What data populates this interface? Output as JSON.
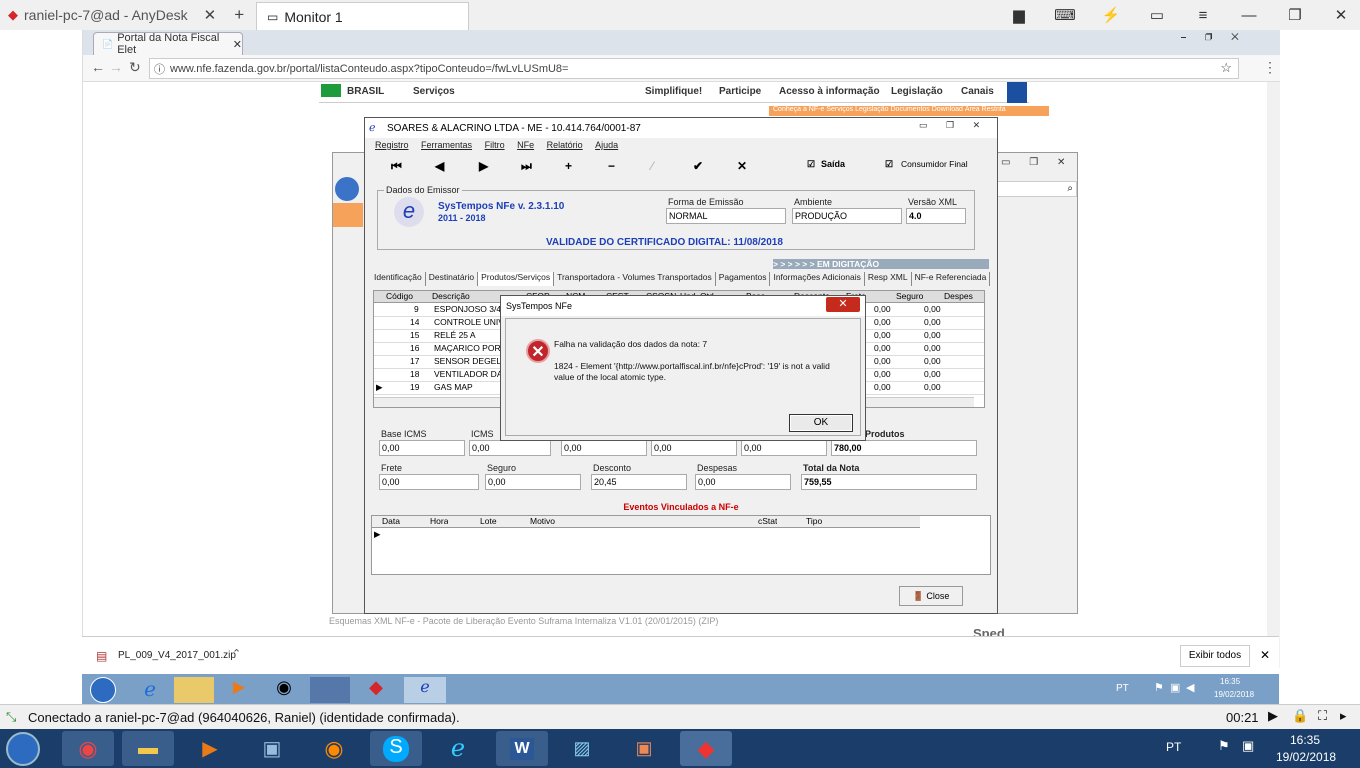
{
  "anydesk": {
    "tab1": "raniel-pc-7@ad - AnyDesk",
    "tab2": "Monitor 1",
    "status": "Conectado a raniel-pc-7@ad (964040626, Raniel) (identidade confirmada).",
    "timer": "00:21"
  },
  "browser": {
    "tab_title": "Portal da Nota Fiscal Elet",
    "url": "www.nfe.fazenda.gov.br/portal/listaConteudo.aspx?tipoConteudo=/fwLvLUSmU8=",
    "gov_brasil": "BRASIL",
    "gov_servicos": "Serviços",
    "gov_links": [
      "Simplifique!",
      "Participe",
      "Acesso à informação",
      "Legislação",
      "Canais"
    ],
    "orange_links": "Conheça a NF-e  Serviços  Legislação  Documentos  Download  Área Restrita",
    "download_file": "PL_009_V4_2017_001.zip",
    "show_all": "Exibir todos",
    "bottom_text": "Esquemas XML NF-e - Pacote de Liberação Evento Suframa Internaliza V1.01 (20/01/2015) (ZIP)",
    "sped": "Sped"
  },
  "remote_tray": {
    "lang": "PT",
    "time": "16:35",
    "date": "19/02/2018"
  },
  "local_tray": {
    "lang": "PT",
    "time": "16:35",
    "date": "19/02/2018"
  },
  "nfe": {
    "title": "SOARES & ALACRINO LTDA - ME - 10.414.764/0001-87",
    "menu": [
      "Registro",
      "Ferramentas",
      "Filtro",
      "NFe",
      "Relatório",
      "Ajuda"
    ],
    "saida_label": "Saída",
    "consumidor_label": "Consumidor Final",
    "dados_emissor": "Dados do Emissor",
    "app_name": "SysTempos NFe v. 2.3.1.10",
    "app_years": "2011 - 2018",
    "forma_label": "Forma de Emissão",
    "forma_value": "NORMAL",
    "ambiente_label": "Ambiente",
    "ambiente_value": "PRODUÇÃO",
    "versao_label": "Versão XML",
    "versao_value": "4.0",
    "validade": "VALIDADE DO CERTIFICADO DIGITAL: 11/08/2018",
    "em_digitacao": "> > > > > >       EM DIGITAÇÃO",
    "tabs": [
      "Identificação",
      "Destinatário",
      "Produtos/Serviços",
      "Transportadora - Volumes Transportados",
      "Pagamentos",
      "Informações Adicionais",
      "Resp XML",
      "NF-e Referenciada"
    ],
    "grid_headers": [
      "Código",
      "Descrição",
      "CFOP",
      "NCM",
      "CEST",
      "CSOSN",
      "Und",
      "Qtd",
      "Base",
      "Desconto",
      "Frete",
      "Seguro",
      "Despes"
    ],
    "grid_rows": [
      {
        "n": "9",
        "desc": "ESPONJOSO 3/4",
        "a": "0,00",
        "b": "0,00"
      },
      {
        "n": "14",
        "desc": "CONTROLE  UNIV",
        "a": "0,00",
        "b": "0,00"
      },
      {
        "n": "15",
        "desc": "RELÉ 25 A",
        "a": "0,00",
        "b": "0,00"
      },
      {
        "n": "16",
        "desc": "MAÇARICO PORT",
        "a": "0,00",
        "b": "0,00"
      },
      {
        "n": "17",
        "desc": "SENSOR DEGELO",
        "a": "0,00",
        "b": "0,00"
      },
      {
        "n": "18",
        "desc": "VENTILADOR DA",
        "a": "0,00",
        "b": "0,00"
      },
      {
        "n": "19",
        "desc": "GAS MAP",
        "a": "0,00",
        "b": "0,00"
      }
    ],
    "base_icms_label": "Base ICMS",
    "base_icms": "0,00",
    "icms_label": "ICMS",
    "icms": "0,00",
    "hidden_c": "0,00",
    "hidden_d": "0,00",
    "hidden_e": "0,00",
    "total_prod_label": "Produtos",
    "total_prod": "780,00",
    "frete_label": "Frete",
    "frete": "0,00",
    "seguro_label": "Seguro",
    "seguro": "0,00",
    "desconto_label": "Desconto",
    "desconto": "20,45",
    "despesas_label": "Despesas",
    "despesas": "0,00",
    "total_nota_label": "Total da Nota",
    "total_nota": "759,55",
    "eventos_title": "Eventos Vinculados a NF-e",
    "eventos_headers": [
      "Data",
      "Hora",
      "Lote",
      "Motivo",
      "cStat",
      "Tipo"
    ],
    "close_label": "Close"
  },
  "dialog": {
    "title": "SysTempos NFe",
    "line1": "Falha na validação dos dados da nota: 7",
    "line2": "1824 - Element '{http://www.portalfiscal.inf.br/nfe}cProd': '19' is not a valid value of the local atomic type.",
    "ok": "OK"
  },
  "colors": {
    "accent_blue": "#1b3d6a",
    "error_red": "#c0262c",
    "nfe_blue": "#1d3fb8",
    "orange": "#f7a25a"
  }
}
